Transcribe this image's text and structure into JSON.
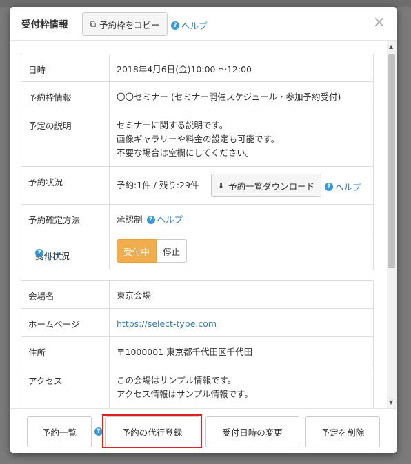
{
  "dialog": {
    "title": "受付枠情報",
    "copy_button_label": "予約枠をコピー",
    "help_label": "ヘルプ",
    "close_label": "×"
  },
  "details": {
    "datetime": {
      "label": "日時",
      "value": "2018年4月6日(金)10:00 〜12:00"
    },
    "slot_info": {
      "label": "予約枠情報",
      "value": "〇〇セミナー (セミナー開催スケジュール・参加予約受付)"
    },
    "description": {
      "label": "予定の説明",
      "lines": [
        "セミナーに関する説明です。",
        "画像ギャラリーや料金の設定も可能です。",
        "不要な場合は空欄にしてください。"
      ]
    },
    "status": {
      "label": "予約状況",
      "value": "予約:1件 / 残り:29件",
      "download_label": "予約一覧ダウンロード",
      "help_label": "ヘルプ"
    },
    "confirm_method": {
      "label": "予約確定方法",
      "value": "承認制",
      "help_label": "ヘルプ"
    },
    "acceptance": {
      "label": "受付状況",
      "help_label": "ヘルプ",
      "on_label": "受付中",
      "off_label": "停止",
      "selected": "受付中"
    }
  },
  "venue": {
    "name": {
      "label": "会場名",
      "value": "東京会場"
    },
    "homepage": {
      "label": "ホームページ",
      "value": "https://select-type.com"
    },
    "address": {
      "label": "住所",
      "value": "〒1000001 東京都千代田区千代田"
    },
    "access": {
      "label": "アクセス",
      "lines": [
        "この会場はサンプル情報です。",
        "アクセス情報はサンプル情報です。"
      ]
    }
  },
  "footer": {
    "list_label": "予約一覧",
    "proxy_register_label": "予約の代行登録",
    "change_datetime_label": "受付日時の変更",
    "delete_label": "予定を削除"
  },
  "colors": {
    "accent_orange": "#f0ad4e",
    "link_blue": "#337ab7",
    "highlight_red": "#e02020"
  }
}
